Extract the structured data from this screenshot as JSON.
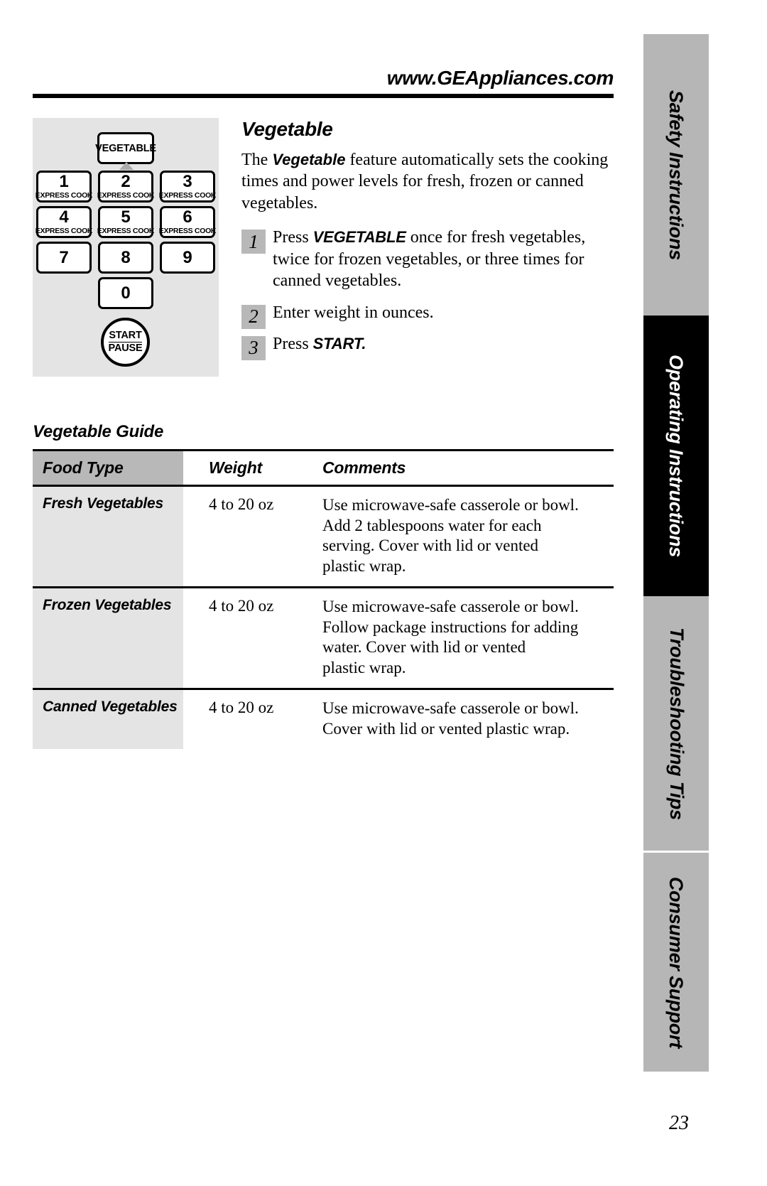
{
  "header": {
    "site_url": "www.GEAppliances.com"
  },
  "sidebar": {
    "tabs": [
      {
        "label": "Safety Instructions",
        "style": "gray"
      },
      {
        "label": "Operating Instructions",
        "style": "black"
      },
      {
        "label": "Troubleshooting Tips",
        "style": "gray"
      },
      {
        "label": "Consumer Support",
        "style": "gray"
      }
    ]
  },
  "keypad": {
    "vegetable_button": "VEGETABLE",
    "express_cook_label": "EXPRESS COOK",
    "keys": [
      {
        "digit": "1",
        "sub": "EXPRESS COOK"
      },
      {
        "digit": "2",
        "sub": "EXPRESS COOK"
      },
      {
        "digit": "3",
        "sub": "EXPRESS COOK"
      },
      {
        "digit": "4",
        "sub": "EXPRESS COOK"
      },
      {
        "digit": "5",
        "sub": "EXPRESS COOK"
      },
      {
        "digit": "6",
        "sub": "EXPRESS COOK"
      },
      {
        "digit": "7",
        "sub": ""
      },
      {
        "digit": "8",
        "sub": ""
      },
      {
        "digit": "9",
        "sub": ""
      },
      {
        "digit": "0",
        "sub": ""
      }
    ],
    "start_label": "START",
    "pause_label": "PAUSE"
  },
  "feature": {
    "title": "Vegetable",
    "intro_before": "The ",
    "intro_emph": "Vegetable",
    "intro_after": " feature automatically sets the cooking times and power levels for fresh, frozen or canned vegetables.",
    "steps": [
      {
        "number": "1",
        "text_before": "Press ",
        "emph": "VEGETABLE",
        "text_after": " once for fresh vegetables, twice for frozen vegetables, or three times for canned vegetables."
      },
      {
        "number": "2",
        "text_before": "Enter weight in ounces.",
        "emph": "",
        "text_after": ""
      },
      {
        "number": "3",
        "text_before": "Press ",
        "emph": "START.",
        "text_after": ""
      }
    ]
  },
  "guide": {
    "title": "Vegetable Guide",
    "columns": [
      "Food Type",
      "Weight",
      "Comments"
    ],
    "rows": [
      {
        "food_type": "Fresh Vegetables",
        "weight": "4 to 20 oz",
        "comment_lines": [
          "Use microwave-safe casserole or bowl.",
          "Add 2 tablespoons water for each",
          "serving. Cover with lid or vented",
          "plastic wrap."
        ]
      },
      {
        "food_type": "Frozen Vegetables",
        "weight": "4 to 20 oz",
        "comment_lines": [
          "Use microwave-safe casserole or bowl.",
          "Follow package instructions for adding",
          "water. Cover with lid or vented",
          "plastic wrap."
        ]
      },
      {
        "food_type": "Canned Vegetables",
        "weight": "4 to 20 oz",
        "comment_lines": [
          "Use microwave-safe casserole or bowl.",
          "Cover with lid or vented plastic wrap."
        ]
      }
    ]
  },
  "footer": {
    "page_number": "23"
  },
  "colors": {
    "panel_gray": "#e4e4e4",
    "tab_gray": "#b6b6b6",
    "tab_active": "#000000",
    "header_gray": "#b8b8b8",
    "row_gray": "#e4e4e4"
  }
}
